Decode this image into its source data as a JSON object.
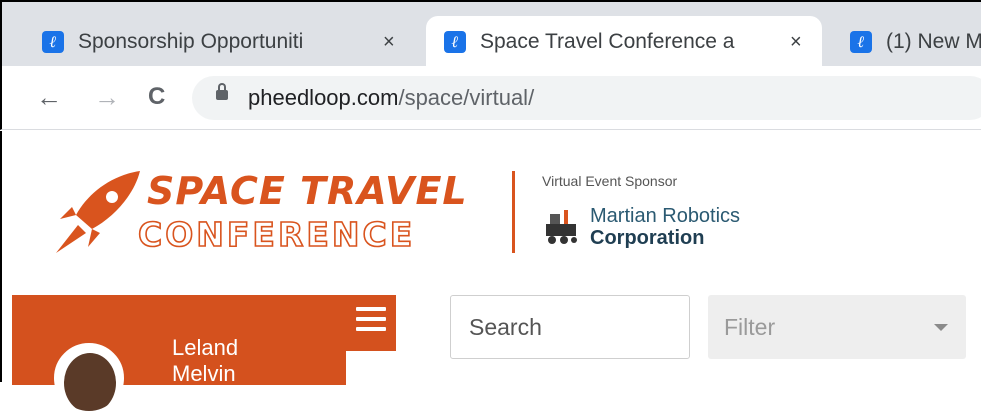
{
  "browser": {
    "tabs": [
      {
        "title": "Sponsorship Opportuniti",
        "favicon_glyph": "ℓ",
        "close": "×",
        "active": false
      },
      {
        "title": "Space Travel Conference a",
        "favicon_glyph": "ℓ",
        "close": "×",
        "active": true
      },
      {
        "title": "(1) New M",
        "favicon_glyph": "ℓ",
        "active": false
      }
    ],
    "nav": {
      "back": "←",
      "forward": "→",
      "reload": "C"
    },
    "url": {
      "host": "pheedloop.com",
      "path": "/space/virtual/"
    }
  },
  "header": {
    "logo_line1": "SPACE TRAVEL",
    "logo_line2": "CONFERENCE",
    "sponsor_label": "Virtual Event Sponsor",
    "sponsor_name_line1": "Martian Robotics",
    "sponsor_name_line2": "Corporation"
  },
  "sidebar": {
    "user_name_line1": "Leland",
    "user_name_line2": "Melvin"
  },
  "search": {
    "placeholder": "Search"
  },
  "filter": {
    "label": "Filter"
  },
  "colors": {
    "brand_orange": "#d9541e",
    "sidebar_bg": "#d4511e",
    "sponsor_blue": "#2b5a72",
    "favicon_blue": "#1a73e8"
  }
}
